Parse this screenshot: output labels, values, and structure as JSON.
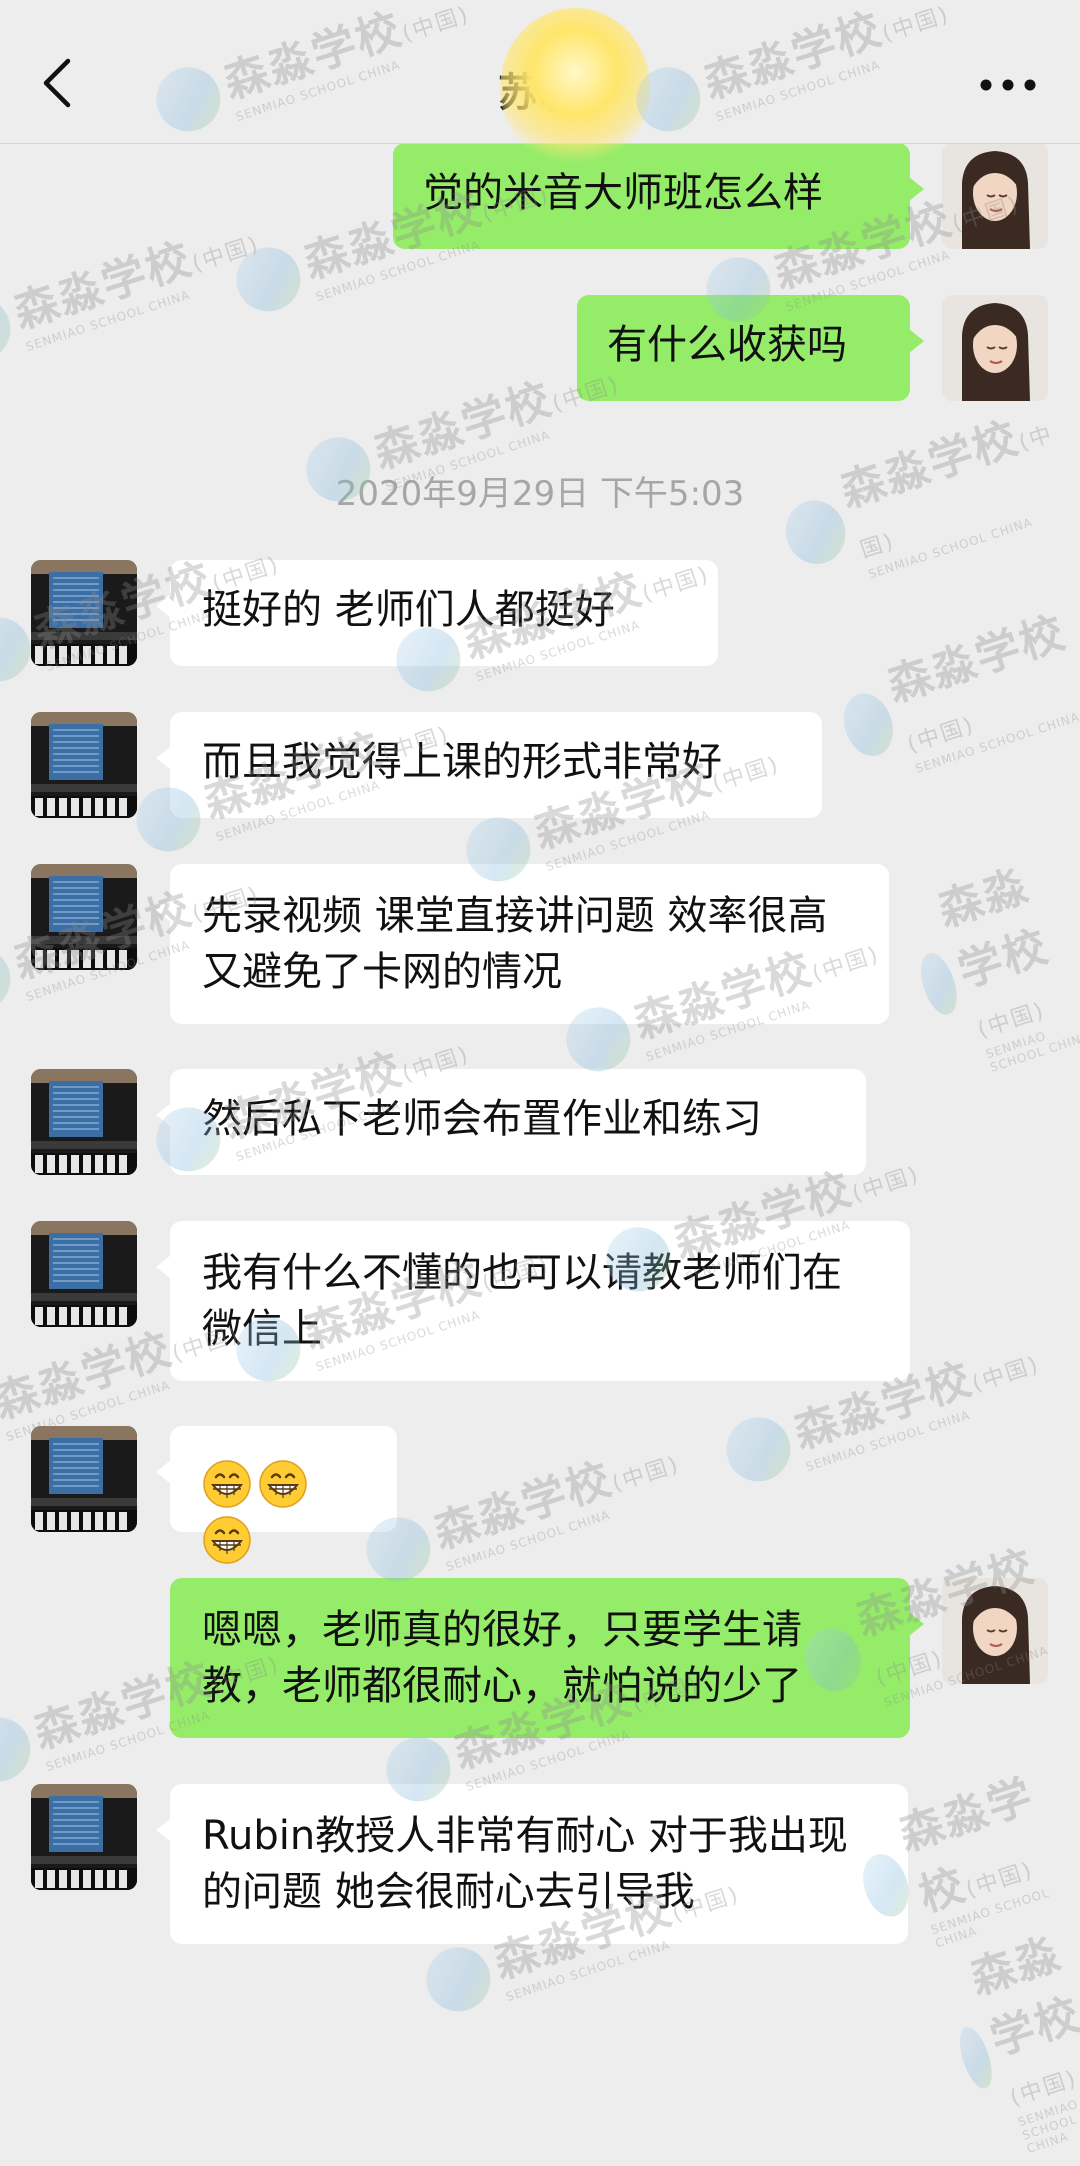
{
  "header": {
    "title": "苏岩",
    "back_icon": "chevron-left-icon",
    "more_icon": "ellipsis-icon"
  },
  "timestamp": "2020年9月29日 下午5:03",
  "messages": [
    {
      "sender": "self",
      "text": "觉的米音大师班怎么样"
    },
    {
      "sender": "self",
      "text": "有什么收获吗"
    },
    {
      "sender": "other",
      "text": "挺好的 老师们人都挺好"
    },
    {
      "sender": "other",
      "text": "而且我觉得上课的形式非常好"
    },
    {
      "sender": "other",
      "text": "先录视频 课堂直接讲问题 效率很高 又避免了卡网的情况"
    },
    {
      "sender": "other",
      "text": "然后私下老师会布置作业和练习"
    },
    {
      "sender": "other",
      "text": "我有什么不懂的也可以请教老师们在微信上"
    },
    {
      "sender": "other",
      "text": "",
      "emojis": [
        "grinning-face-icon",
        "grinning-face-icon",
        "grinning-face-icon"
      ]
    },
    {
      "sender": "self",
      "text": "嗯嗯，老师真的很好，只要学生请教，老师都很耐心，就怕说的少了"
    },
    {
      "sender": "other",
      "text": "Rubin教授人非常有耐心 对于我出现的问题 她会很耐心去引导我"
    }
  ],
  "watermark": {
    "text": "森淼学校",
    "suffix": "(中国)",
    "subtext": "SENMIAO SCHOOL CHINA"
  },
  "colors": {
    "background": "#ededed",
    "sent_bubble": "#95ec69",
    "received_bubble": "#ffffff",
    "timestamp_text": "#a6a6a6"
  }
}
